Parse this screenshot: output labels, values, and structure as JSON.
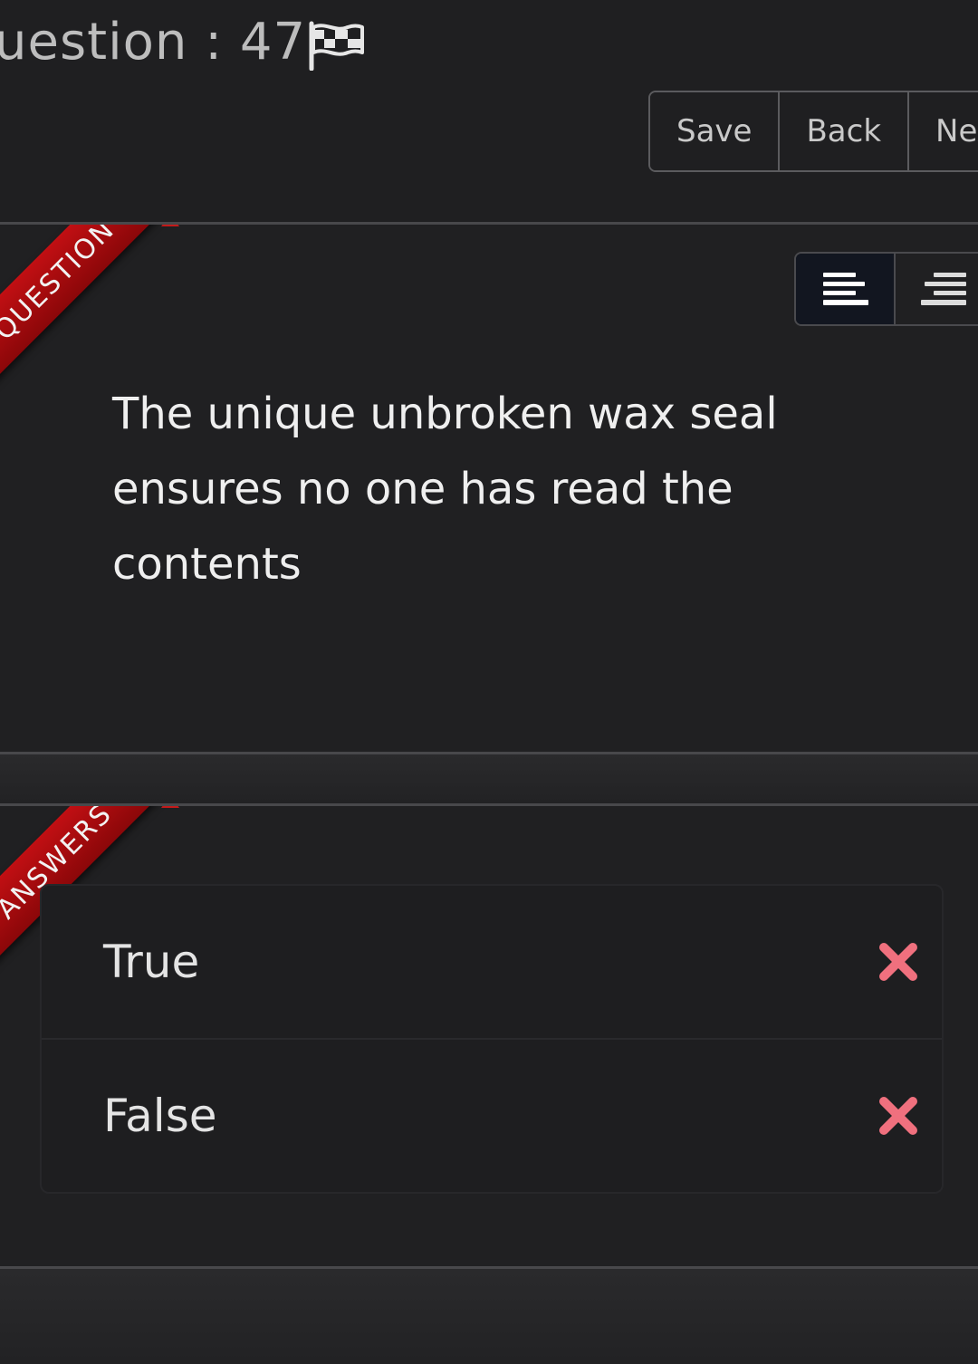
{
  "header": {
    "title": "uestion : 47",
    "icons": {
      "flag": "checkered-flag-icon"
    }
  },
  "toolbar": {
    "buttons": [
      {
        "label": "Save"
      },
      {
        "label": "Back"
      },
      {
        "label": "Nex"
      }
    ]
  },
  "question_panel": {
    "ribbon": "QUESTION",
    "align_options": [
      {
        "icon": "align-left-icon",
        "active": true
      },
      {
        "icon": "align-right-icon",
        "active": false
      }
    ],
    "text": "The unique unbroken wax seal ensures no one has read the contents"
  },
  "answers_panel": {
    "ribbon": "ANSWERS",
    "answers": [
      {
        "label": "True",
        "icon": "cross-icon"
      },
      {
        "label": "False",
        "icon": "cross-icon"
      }
    ]
  },
  "colors": {
    "background": "#1f1f21",
    "ribbon": "#b20c0f",
    "cross": "#f0707e",
    "active_toggle": "#121620"
  }
}
